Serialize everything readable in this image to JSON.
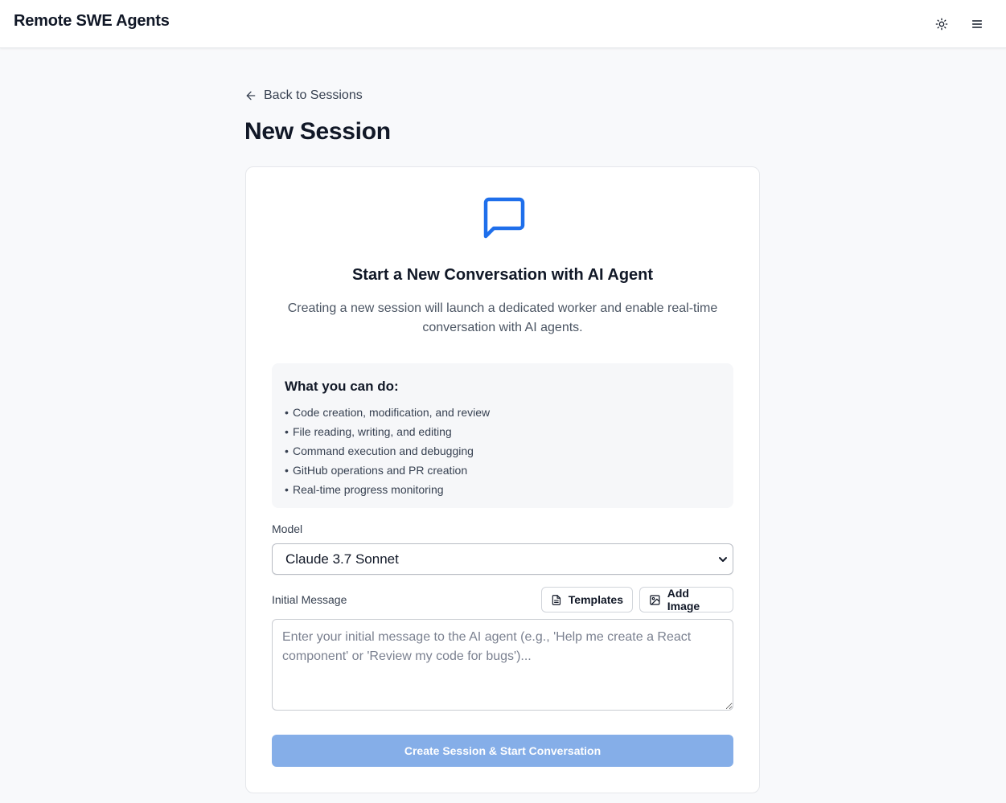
{
  "header": {
    "app_title": "Remote SWE Agents",
    "theme_toggle_icon": "sun-icon",
    "menu_icon": "hamburger-menu-icon"
  },
  "nav": {
    "back_label": "Back to Sessions",
    "back_icon": "arrow-left-icon"
  },
  "page": {
    "title": "New Session"
  },
  "card": {
    "icon": "chat-bubble-icon",
    "heading": "Start a New Conversation with AI Agent",
    "description": "Creating a new session will launch a dedicated worker and enable real-time conversation with AI agents.",
    "features": {
      "title": "What you can do:",
      "items": [
        "Code creation, modification, and review",
        "File reading, writing, and editing",
        "Command execution and debugging",
        "GitHub operations and PR creation",
        "Real-time progress monitoring"
      ]
    },
    "model": {
      "label": "Model",
      "selected": "Claude 3.7 Sonnet"
    },
    "message": {
      "label": "Initial Message",
      "placeholder": "Enter your initial message to the AI agent (e.g., 'Help me create a React component' or 'Review my code for bugs')...",
      "value": "",
      "templates_label": "Templates",
      "add_image_label": "Add Image"
    },
    "submit_label": "Create Session & Start Conversation"
  },
  "colors": {
    "accent": "#1f6feb",
    "submit_disabled": "#85aee8",
    "page_bg": "#f8f9fb"
  }
}
